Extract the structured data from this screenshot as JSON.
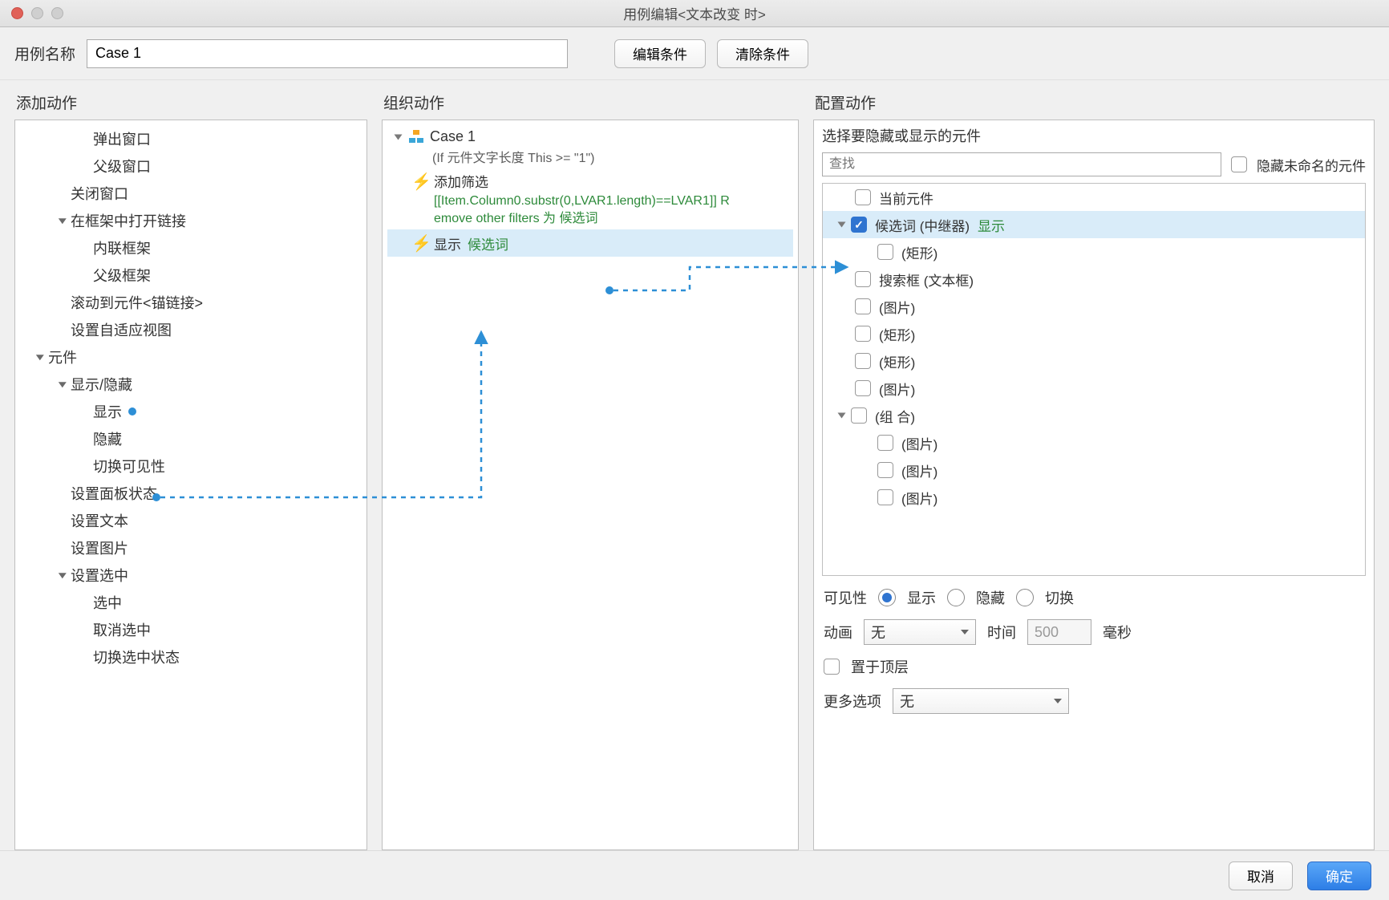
{
  "window_title": "用例编辑<文本改变 时>",
  "toprow": {
    "name_label": "用例名称",
    "name_value": "Case 1",
    "edit_cond": "编辑条件",
    "clear_cond": "清除条件"
  },
  "col_headers": {
    "add": "添加动作",
    "org": "组织动作",
    "cfg": "配置动作"
  },
  "add_actions": [
    {
      "lvl": 3,
      "text": "弹出窗口"
    },
    {
      "lvl": 3,
      "text": "父级窗口"
    },
    {
      "lvl": 2,
      "text": "关闭窗口"
    },
    {
      "lvl": 2,
      "text": "在框架中打开链接",
      "exp": true
    },
    {
      "lvl": 3,
      "text": "内联框架"
    },
    {
      "lvl": 3,
      "text": "父级框架"
    },
    {
      "lvl": 2,
      "text": "滚动到元件<锚链接>"
    },
    {
      "lvl": 2,
      "text": "设置自适应视图"
    },
    {
      "lvl": 1,
      "text": "元件",
      "exp": true
    },
    {
      "lvl": 2,
      "text": "显示/隐藏",
      "exp": true
    },
    {
      "lvl": 3,
      "text": "显示",
      "hl": true
    },
    {
      "lvl": 3,
      "text": "隐藏"
    },
    {
      "lvl": 3,
      "text": "切换可见性"
    },
    {
      "lvl": 2,
      "text": "设置面板状态"
    },
    {
      "lvl": 2,
      "text": "设置文本"
    },
    {
      "lvl": 2,
      "text": "设置图片"
    },
    {
      "lvl": 2,
      "text": "设置选中",
      "exp": true
    },
    {
      "lvl": 3,
      "text": "选中"
    },
    {
      "lvl": 3,
      "text": "取消选中"
    },
    {
      "lvl": 3,
      "text": "切换选中状态"
    }
  ],
  "org": {
    "case_name": "Case 1",
    "condition": "(If 元件文字长度 This >= \"1\")",
    "action1_label": "添加筛选",
    "action1_detail": "[[Item.Column0.substr(0,LVAR1.length)==LVAR1]] Remove other filters 为 候选词",
    "action2_label": "显示",
    "action2_target": "候选词"
  },
  "cfg": {
    "header": "选择要隐藏或显示的元件",
    "search_placeholder": "查找",
    "hide_unnamed": "隐藏未命名的元件",
    "widgets": [
      {
        "lvl": 0,
        "text": "当前元件",
        "chk": false,
        "disc": false
      },
      {
        "lvl": 0,
        "text": "候选词 (中继器)",
        "chk": true,
        "disc": true,
        "sel": true,
        "suffix": "显示"
      },
      {
        "lvl": 1,
        "text": "(矩形)",
        "chk": false,
        "disc": false
      },
      {
        "lvl": 0,
        "text": "搜索框 (文本框)",
        "chk": false,
        "disc": false
      },
      {
        "lvl": 0,
        "text": "(图片)",
        "chk": false,
        "disc": false
      },
      {
        "lvl": 0,
        "text": "(矩形)",
        "chk": false,
        "disc": false
      },
      {
        "lvl": 0,
        "text": "(矩形)",
        "chk": false,
        "disc": false
      },
      {
        "lvl": 0,
        "text": "(图片)",
        "chk": false,
        "disc": false
      },
      {
        "lvl": 0,
        "text": "(组 合)",
        "chk": false,
        "disc": true
      },
      {
        "lvl": 1,
        "text": "(图片)",
        "chk": false,
        "disc": false
      },
      {
        "lvl": 1,
        "text": "(图片)",
        "chk": false,
        "disc": false
      },
      {
        "lvl": 1,
        "text": "(图片)",
        "chk": false,
        "disc": false
      }
    ],
    "visibility_label": "可见性",
    "vis_show": "显示",
    "vis_hide": "隐藏",
    "vis_toggle": "切换",
    "anim_label": "动画",
    "anim_value": "无",
    "time_label": "时间",
    "time_value": "500",
    "time_unit": "毫秒",
    "bring_front": "置于顶层",
    "more_label": "更多选项",
    "more_value": "无"
  },
  "footer": {
    "cancel": "取消",
    "ok": "确定"
  }
}
